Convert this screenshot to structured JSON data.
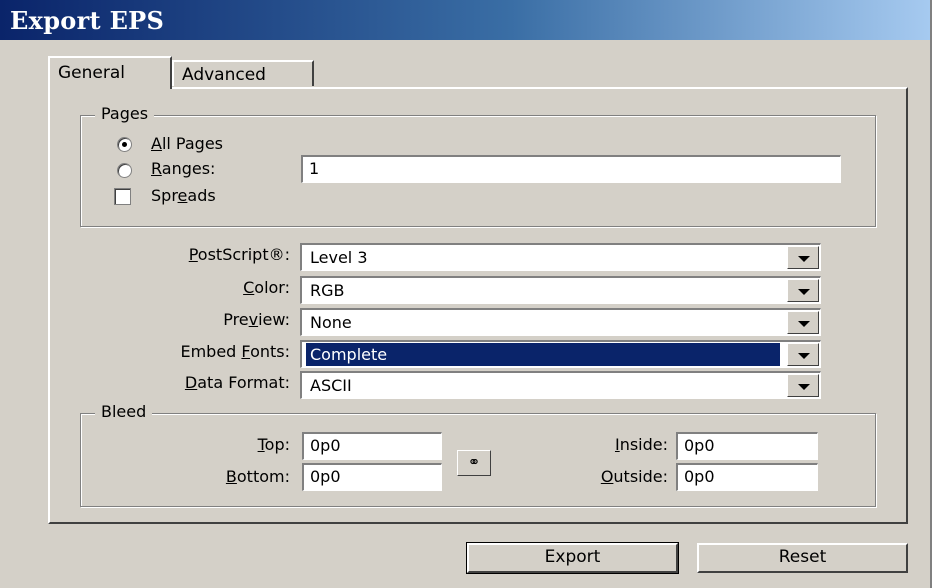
{
  "window": {
    "title": "Export EPS"
  },
  "tabs": [
    {
      "label": "General"
    },
    {
      "label": "Advanced"
    }
  ],
  "pages": {
    "group_label": "Pages",
    "all_pages": {
      "label": "All Pages",
      "selected": true
    },
    "ranges": {
      "label": "Ranges:",
      "value": "1",
      "selected": false
    },
    "spreads": {
      "label": "Spreads",
      "checked": false
    }
  },
  "options": {
    "postscript": {
      "label": "PostScript®:",
      "value": "Level 3"
    },
    "color": {
      "label": "Color:",
      "value": "RGB"
    },
    "preview": {
      "label": "Preview:",
      "value": "None"
    },
    "embed_fonts": {
      "label": "Embed Fonts:",
      "value": "Complete"
    },
    "data_format": {
      "label": "Data Format:",
      "value": "ASCII"
    }
  },
  "bleed": {
    "group_label": "Bleed",
    "top": {
      "label": "Top:",
      "value": "0p0"
    },
    "bottom": {
      "label": "Bottom:",
      "value": "0p0"
    },
    "inside": {
      "label": "Inside:",
      "value": "0p0"
    },
    "outside": {
      "label": "Outside:",
      "value": "0p0"
    },
    "link_icon": "chain-link-icon"
  },
  "buttons": {
    "export": "Export",
    "reset": "Reset"
  }
}
